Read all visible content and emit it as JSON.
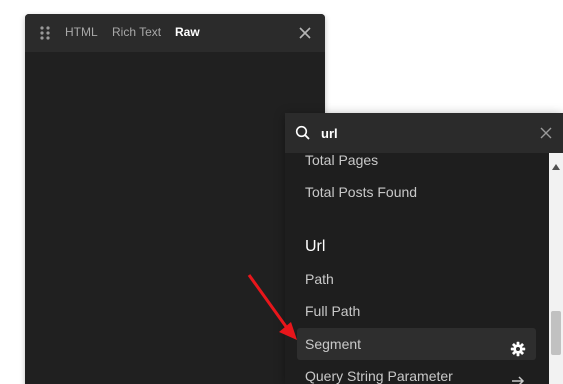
{
  "editor": {
    "tabs": [
      {
        "label": "HTML"
      },
      {
        "label": "Rich Text"
      },
      {
        "label": "Raw"
      }
    ],
    "active_tab": "Raw"
  },
  "search": {
    "value": "url"
  },
  "list": {
    "items_before": [
      "Total Pages",
      "Total Posts Found"
    ],
    "group_title": "Url",
    "group_items": [
      "Path",
      "Full Path",
      "Segment",
      "Query String Parameter"
    ],
    "highlighted_item": "Segment"
  },
  "colors": {
    "panel_bg": "#202020",
    "header_bg": "#2b2b2b",
    "highlight_bg": "#2e2e2e",
    "annotation": "#e8161b"
  },
  "icons": {
    "drag": "drag-handle-icon",
    "close": "close-icon",
    "search": "search-icon",
    "clear": "clear-icon",
    "settings": "gear-icon",
    "arrow": "arrow-right-icon"
  }
}
